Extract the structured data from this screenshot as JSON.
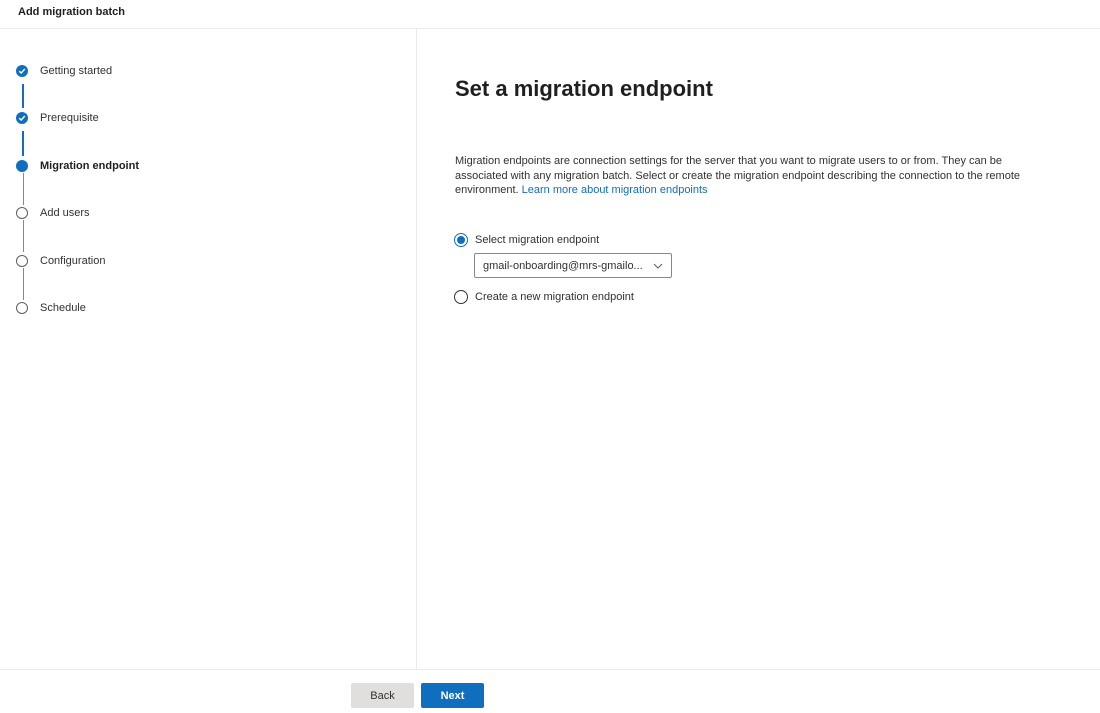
{
  "panel": {
    "title": "Add migration batch"
  },
  "steps": [
    {
      "label": "Getting started",
      "state": "done"
    },
    {
      "label": "Prerequisite",
      "state": "done"
    },
    {
      "label": "Migration endpoint",
      "state": "current"
    },
    {
      "label": "Add users",
      "state": "todo"
    },
    {
      "label": "Configuration",
      "state": "todo"
    },
    {
      "label": "Schedule",
      "state": "todo"
    }
  ],
  "main": {
    "title": "Set a migration endpoint",
    "description": "Migration endpoints are connection settings for the server that you want to migrate users to or from. They can be associated with any migration batch. Select or create the migration endpoint describing the connection to the remote environment.",
    "learn_more_link": "Learn more about migration endpoints",
    "options": {
      "select_label": "Select migration endpoint",
      "create_label": "Create a new migration endpoint",
      "selected": "select"
    },
    "endpoint_dropdown": {
      "value": "gmail-onboarding@mrs-gmailo..."
    }
  },
  "footer": {
    "back_label": "Back",
    "next_label": "Next"
  },
  "colors": {
    "accent": "#106ebe",
    "secondary_button": "#e1dfdd",
    "divider": "#edebe9"
  }
}
